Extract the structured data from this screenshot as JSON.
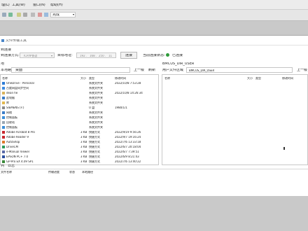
{
  "ide": {
    "menus": [
      "理(L)",
      "工具(W)",
      "窗口(N)",
      "帮助(H)"
    ],
    "toolbar_dropdown": "完成"
  },
  "window": {
    "title": "文件传输工具"
  },
  "connection": {
    "section_label": "到连接",
    "mode_label": "到连接方式:",
    "mode_value": "TCP/IP协议",
    "address_label": "目标地址:",
    "ip": [
      "192",
      "168",
      "250",
      "11"
    ],
    "connect_button": "连接",
    "status_label": "当前连接状态:",
    "status_value": "已连接",
    "status_color": "#2e9a3a"
  },
  "local": {
    "section_label": "地",
    "path_label": "本地路径",
    "path": "桌面",
    "up_button": "上一级",
    "refresh_button": "刷新",
    "columns": [
      "名称",
      "大小",
      "类型",
      "修改时间"
    ],
    "files": [
      {
        "name": "OneDrive - Personal",
        "size": "",
        "type": "系统文件夹",
        "date": "2022/10/8 7:53:28",
        "color": "#2b7bd6"
      },
      {
        "name": "百度网盘同步空间",
        "size": "",
        "type": "系统文件夹",
        "date": "",
        "color": "#3d8be0"
      },
      {
        "name": "dean he",
        "size": "",
        "type": "系统文件夹",
        "date": "2022/10/8 14:26:34",
        "color": "#d9b25a"
      },
      {
        "name": "此电脑",
        "size": "",
        "type": "系统文件夹",
        "date": "",
        "color": "#3a7cc8"
      },
      {
        "name": "库",
        "size": "",
        "type": "系统文件夹",
        "date": "",
        "color": "#e2b84c"
      },
      {
        "name": "SIEMENS (F:)",
        "size": "",
        "type": "U 盘",
        "date": "1980/1/1",
        "color": "#8a8a8a"
      },
      {
        "name": "网络",
        "size": "",
        "type": "系统文件夹",
        "date": "",
        "color": "#3a7cc8"
      },
      {
        "name": "控制面板",
        "size": "",
        "type": "系统文件夹",
        "date": "",
        "color": "#3b8ed8"
      },
      {
        "name": "回收站",
        "size": "",
        "type": "系统文件夹",
        "date": "",
        "color": "#9aa7b3"
      },
      {
        "name": "控制面板",
        "size": "",
        "type": "系统文件夹",
        "date": "",
        "color": "#3b8ed8"
      },
      {
        "name": "Adobe Acrobat 8 Pro",
        "size": "3 KB",
        "type": "快捷方式",
        "date": "2022/9/19 9:56:26",
        "color": "#c8282d"
      },
      {
        "name": "Adobe Reader 9",
        "size": "3 KB",
        "type": "快捷方式",
        "date": "2022/9/7 19:16:24",
        "color": "#c8282d"
      },
      {
        "name": "AutoShop",
        "size": "3 KB",
        "type": "快捷方式",
        "date": "2022/7/6 13:33:18",
        "color": "#e07a2a"
      },
      {
        "name": "DriveCM",
        "size": "3 KB",
        "type": "快捷方式",
        "date": "2022/6/7 20:18:04",
        "color": "#2a9a5a"
      },
      {
        "name": "e-Manual Viewer",
        "size": "3 KB",
        "type": "快捷方式",
        "date": "2022/6/7 7:39:51",
        "color": "#5a6aa8"
      },
      {
        "name": "EPSON PC+ 7.0",
        "size": "3 KB",
        "type": "快捷方式",
        "date": "2022/6/9 8:21:43",
        "color": "#2a4fa0"
      },
      {
        "name": "GP-Pro EX 4.09 SP1",
        "size": "3 KB",
        "type": "快捷方式",
        "date": "2022/7/6 13:40:22",
        "color": "#3a8a3a"
      }
    ]
  },
  "remote": {
    "title": "BMCUS_DIR_USER",
    "path_label": "用户文件区域",
    "path": "BMCUS_DIR_USER",
    "up_button": "上一级",
    "columns": [
      "名称",
      "大小",
      "类型",
      "修改时间"
    ]
  },
  "log": {
    "tabs": [
      "列",
      "日志"
    ],
    "columns": [
      "文件名称",
      "传输进度",
      "状态",
      "本地路径"
    ]
  }
}
